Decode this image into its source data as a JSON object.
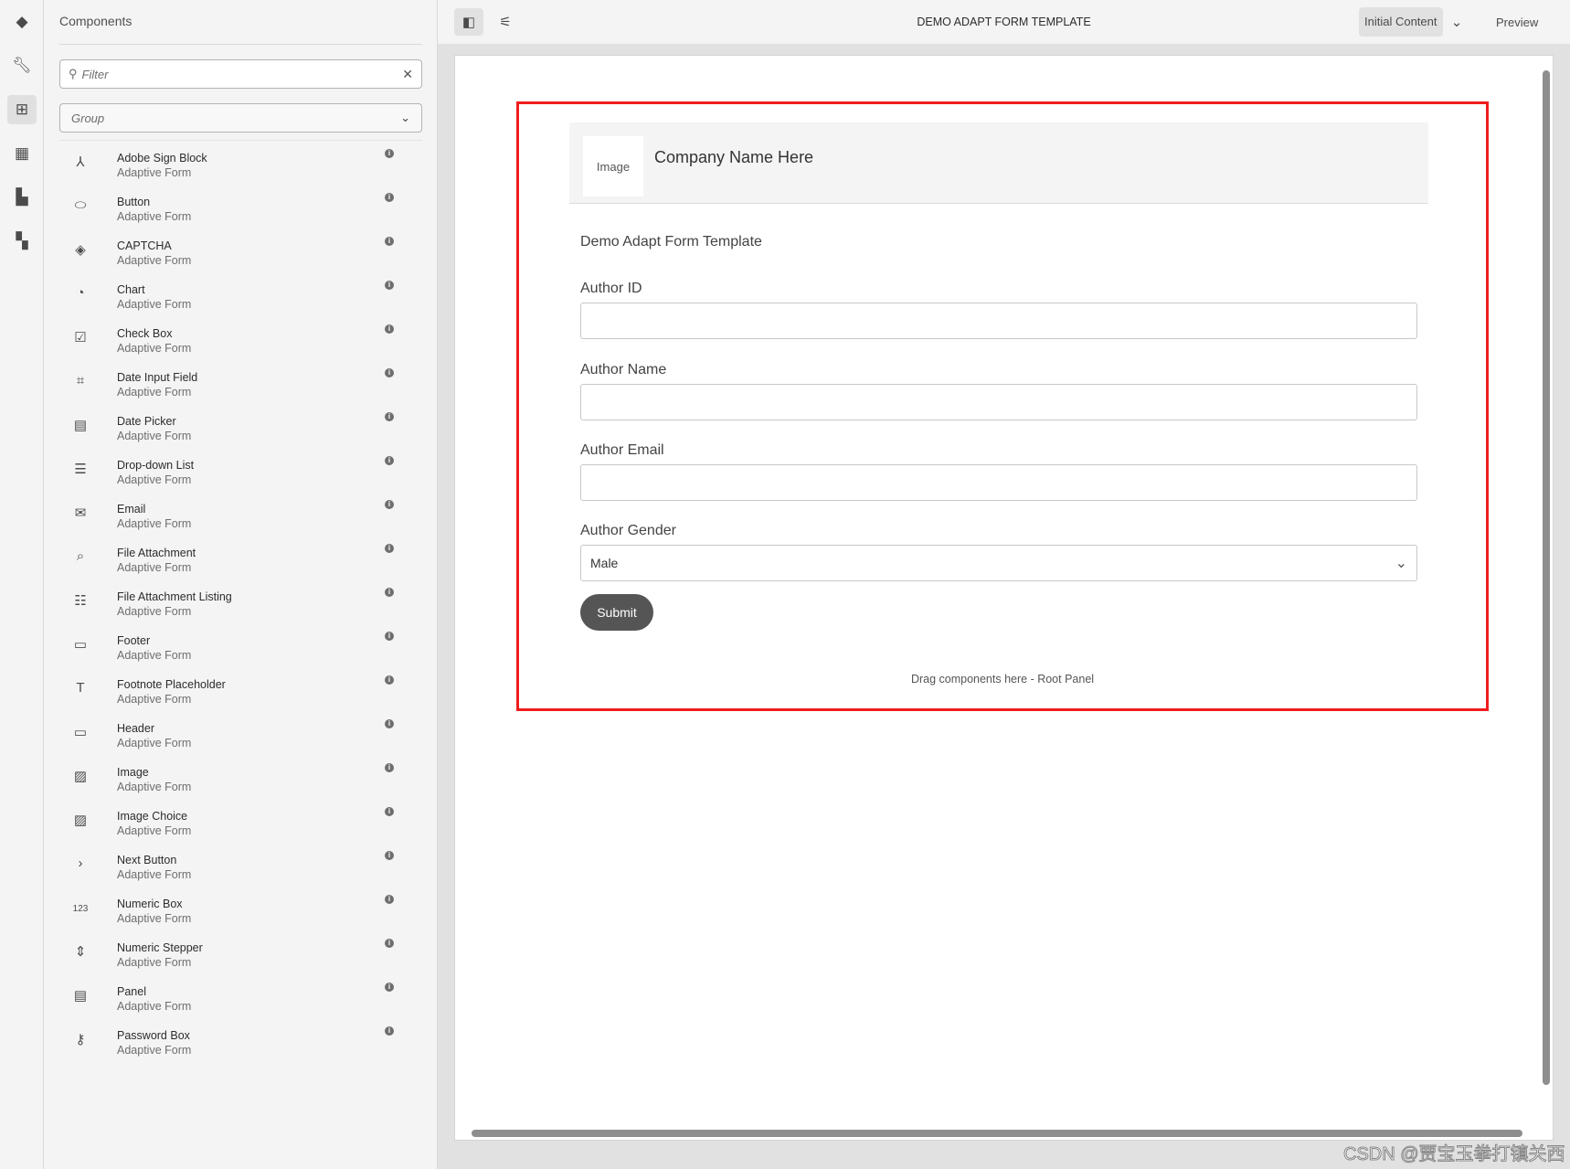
{
  "rail": {
    "icons": [
      "layers-icon",
      "wrench-icon",
      "add-component-icon",
      "assets-icon",
      "pdf-icon",
      "data-sources-icon"
    ]
  },
  "panel": {
    "title": "Components",
    "filter_placeholder": "Filter",
    "group_value": "Group",
    "items": [
      {
        "name": "Adobe Sign Block",
        "group": "Adaptive Form",
        "icon": "⅄"
      },
      {
        "name": "Button",
        "group": "Adaptive Form",
        "icon": "⬭"
      },
      {
        "name": "CAPTCHA",
        "group": "Adaptive Form",
        "icon": "◈"
      },
      {
        "name": "Chart",
        "group": "Adaptive Form",
        "icon": "◔"
      },
      {
        "name": "Check Box",
        "group": "Adaptive Form",
        "icon": "☑"
      },
      {
        "name": "Date Input Field",
        "group": "Adaptive Form",
        "icon": "⌗"
      },
      {
        "name": "Date Picker",
        "group": "Adaptive Form",
        "icon": "▤"
      },
      {
        "name": "Drop-down List",
        "group": "Adaptive Form",
        "icon": "☰"
      },
      {
        "name": "Email",
        "group": "Adaptive Form",
        "icon": "✉"
      },
      {
        "name": "File Attachment",
        "group": "Adaptive Form",
        "icon": "⌕"
      },
      {
        "name": "File Attachment Listing",
        "group": "Adaptive Form",
        "icon": "☷"
      },
      {
        "name": "Footer",
        "group": "Adaptive Form",
        "icon": "▭"
      },
      {
        "name": "Footnote Placeholder",
        "group": "Adaptive Form",
        "icon": "T"
      },
      {
        "name": "Header",
        "group": "Adaptive Form",
        "icon": "▭"
      },
      {
        "name": "Image",
        "group": "Adaptive Form",
        "icon": "▨"
      },
      {
        "name": "Image Choice",
        "group": "Adaptive Form",
        "icon": "▨"
      },
      {
        "name": "Next Button",
        "group": "Adaptive Form",
        "icon": "›"
      },
      {
        "name": "Numeric Box",
        "group": "Adaptive Form",
        "icon": "123"
      },
      {
        "name": "Numeric Stepper",
        "group": "Adaptive Form",
        "icon": "⇕"
      },
      {
        "name": "Panel",
        "group": "Adaptive Form",
        "icon": "▤"
      },
      {
        "name": "Password Box",
        "group": "Adaptive Form",
        "icon": "⚷"
      }
    ]
  },
  "topbar": {
    "title": "DEMO ADAPT FORM TEMPLATE",
    "initial_content": "Initial Content",
    "preview": "Preview"
  },
  "form": {
    "image_label": "Image",
    "company_name": "Company Name Here",
    "title": "Demo Adapt Form Template",
    "fields": [
      {
        "label": "Author ID",
        "value": ""
      },
      {
        "label": "Author Name",
        "value": ""
      },
      {
        "label": "Author Email",
        "value": ""
      }
    ],
    "gender": {
      "label": "Author Gender",
      "value": "Male"
    },
    "submit": "Submit",
    "drag_hint": "Drag components here - Root Panel"
  },
  "watermark": "CSDN @贾宝玉拳打镇关西",
  "colors": {
    "selection": "#ef1d1d"
  }
}
